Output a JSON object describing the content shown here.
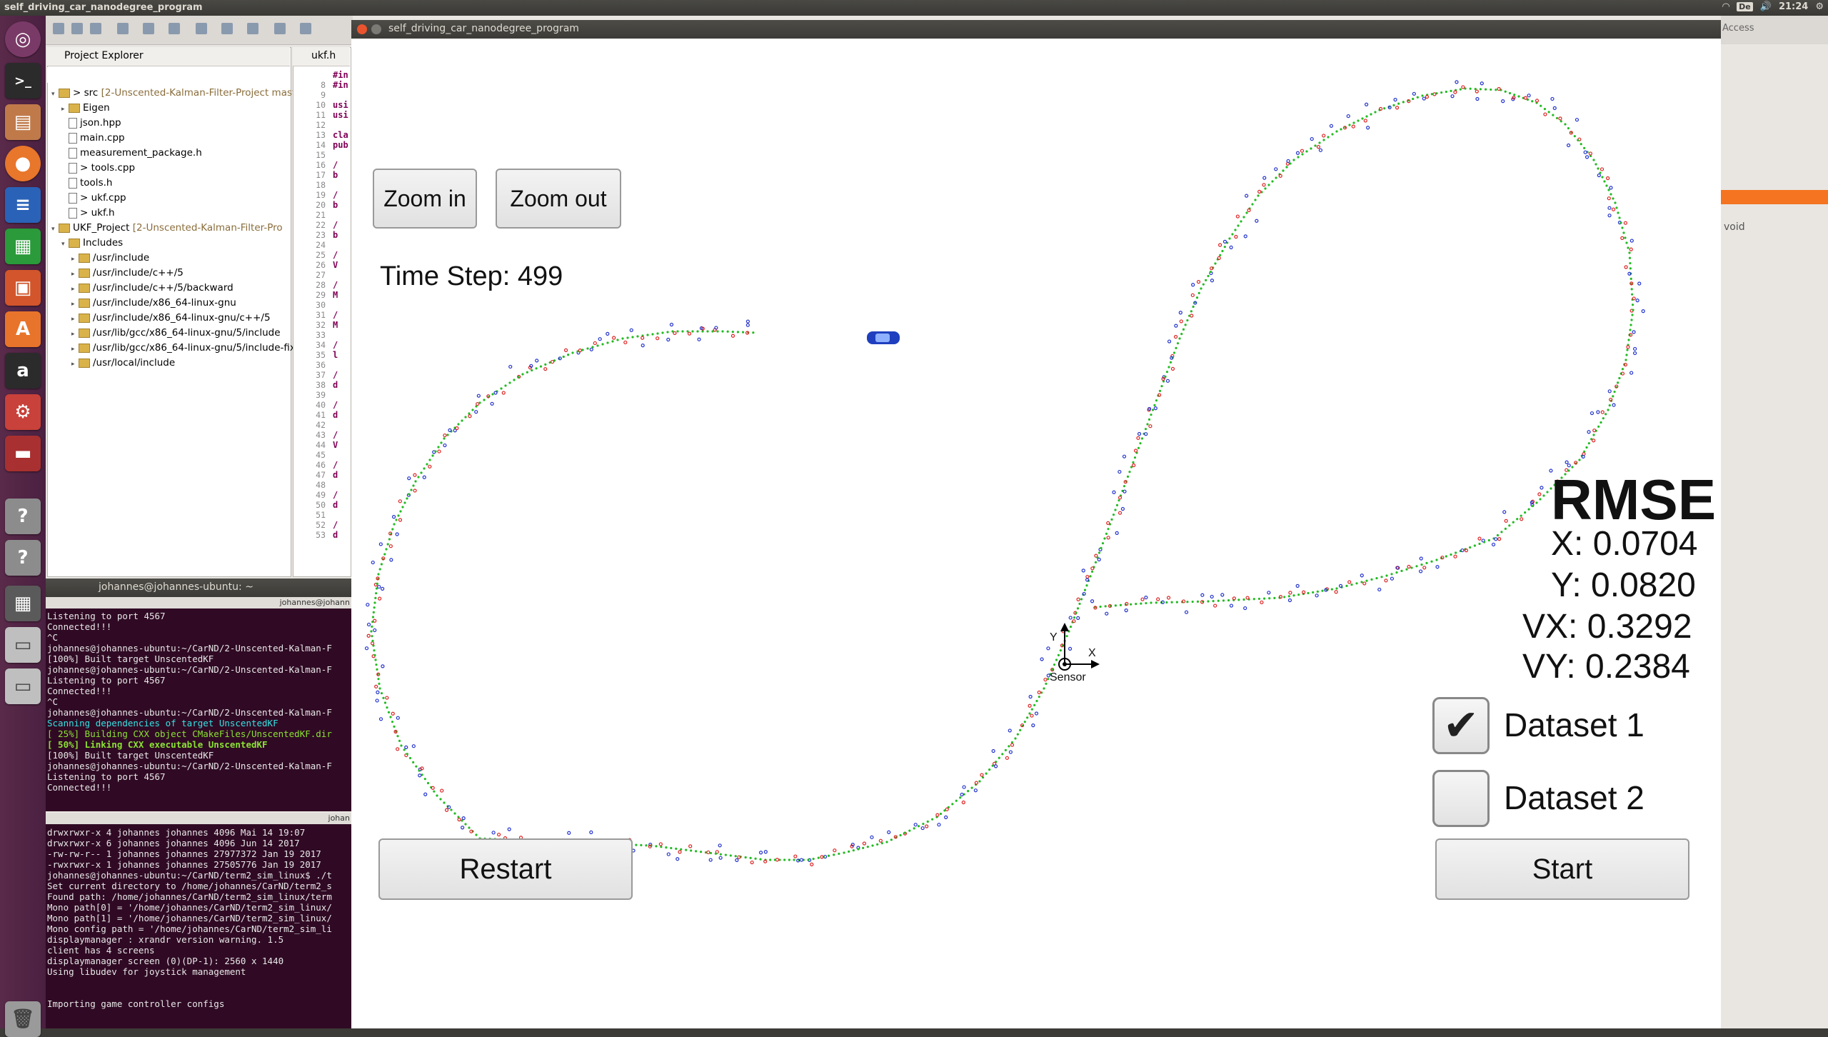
{
  "top_panel": {
    "title": "self_driving_car_nanodegree_program",
    "keyboard": "De",
    "time": "21:24"
  },
  "launcher": {
    "items": [
      "terminal-icon",
      "files-icon",
      "firefox-icon",
      "writer-icon",
      "calc-icon",
      "impress-icon",
      "software-icon",
      "amazon-icon",
      "settings-icon",
      "monitor-icon",
      "unknown-app-icon",
      "unknown-app-icon",
      "calculator-icon",
      "drive-icon",
      "drive-icon",
      "trash-icon"
    ]
  },
  "project_explorer": {
    "title": "Project Explorer",
    "rows": [
      {
        "label": "src",
        "sub": " [2-Unscented-Kalman-Filter-Project mast",
        "depth": 0,
        "type": "folder",
        "expanded": true,
        "prefix": ">"
      },
      {
        "label": "Eigen",
        "sub": "",
        "depth": 1,
        "type": "folder",
        "expanded": false,
        "prefix": ""
      },
      {
        "label": "json.hpp",
        "sub": "",
        "depth": 1,
        "type": "file",
        "prefix": ""
      },
      {
        "label": "main.cpp",
        "sub": "",
        "depth": 1,
        "type": "file",
        "prefix": ""
      },
      {
        "label": "measurement_package.h",
        "sub": "",
        "depth": 1,
        "type": "file",
        "prefix": ""
      },
      {
        "label": "tools.cpp",
        "sub": "",
        "depth": 1,
        "type": "file",
        "prefix": ">"
      },
      {
        "label": "tools.h",
        "sub": "",
        "depth": 1,
        "type": "file",
        "prefix": ""
      },
      {
        "label": "ukf.cpp",
        "sub": "",
        "depth": 1,
        "type": "file",
        "prefix": ">"
      },
      {
        "label": "ukf.h",
        "sub": "",
        "depth": 1,
        "type": "file",
        "prefix": ">"
      },
      {
        "label": "UKF_Project",
        "sub": " [2-Unscented-Kalman-Filter-Pro",
        "depth": 0,
        "type": "folder",
        "expanded": true,
        "prefix": ""
      },
      {
        "label": "Includes",
        "sub": "",
        "depth": 1,
        "type": "folder",
        "expanded": true,
        "prefix": ""
      },
      {
        "label": "/usr/include",
        "sub": "",
        "depth": 2,
        "type": "folder",
        "prefix": ""
      },
      {
        "label": "/usr/include/c++/5",
        "sub": "",
        "depth": 2,
        "type": "folder",
        "prefix": ""
      },
      {
        "label": "/usr/include/c++/5/backward",
        "sub": "",
        "depth": 2,
        "type": "folder",
        "prefix": ""
      },
      {
        "label": "/usr/include/x86_64-linux-gnu",
        "sub": "",
        "depth": 2,
        "type": "folder",
        "prefix": ""
      },
      {
        "label": "/usr/include/x86_64-linux-gnu/c++/5",
        "sub": "",
        "depth": 2,
        "type": "folder",
        "prefix": ""
      },
      {
        "label": "/usr/lib/gcc/x86_64-linux-gnu/5/include",
        "sub": "",
        "depth": 2,
        "type": "folder",
        "prefix": ""
      },
      {
        "label": "/usr/lib/gcc/x86_64-linux-gnu/5/include-fix",
        "sub": "",
        "depth": 2,
        "type": "folder",
        "prefix": ""
      },
      {
        "label": "/usr/local/include",
        "sub": "",
        "depth": 2,
        "type": "folder",
        "prefix": ""
      }
    ]
  },
  "editor": {
    "tab": "ukf.h",
    "lines": [
      {
        "n": "",
        "t": "#in"
      },
      {
        "n": "8",
        "t": "#in"
      },
      {
        "n": "9",
        "t": ""
      },
      {
        "n": "10",
        "t": "usi"
      },
      {
        "n": "11",
        "t": "usi"
      },
      {
        "n": "12",
        "t": ""
      },
      {
        "n": "13",
        "t": "cla"
      },
      {
        "n": "14",
        "t": "pub"
      },
      {
        "n": "15",
        "t": ""
      },
      {
        "n": "16",
        "t": "/"
      },
      {
        "n": "17",
        "t": "b"
      },
      {
        "n": "18",
        "t": ""
      },
      {
        "n": "19",
        "t": "/"
      },
      {
        "n": "20",
        "t": "b"
      },
      {
        "n": "21",
        "t": ""
      },
      {
        "n": "22",
        "t": "/"
      },
      {
        "n": "23",
        "t": "b"
      },
      {
        "n": "24",
        "t": ""
      },
      {
        "n": "25",
        "t": "/"
      },
      {
        "n": "26",
        "t": "V"
      },
      {
        "n": "27",
        "t": ""
      },
      {
        "n": "28",
        "t": "/"
      },
      {
        "n": "29",
        "t": "M"
      },
      {
        "n": "30",
        "t": ""
      },
      {
        "n": "31",
        "t": "/"
      },
      {
        "n": "32",
        "t": "M"
      },
      {
        "n": "33",
        "t": ""
      },
      {
        "n": "34",
        "t": "/"
      },
      {
        "n": "35",
        "t": "l"
      },
      {
        "n": "36",
        "t": ""
      },
      {
        "n": "37",
        "t": "/"
      },
      {
        "n": "38",
        "t": "d"
      },
      {
        "n": "39",
        "t": ""
      },
      {
        "n": "40",
        "t": "/"
      },
      {
        "n": "41",
        "t": "d"
      },
      {
        "n": "42",
        "t": ""
      },
      {
        "n": "43",
        "t": "/"
      },
      {
        "n": "44",
        "t": "V"
      },
      {
        "n": "45",
        "t": ""
      },
      {
        "n": "46",
        "t": "/"
      },
      {
        "n": "47",
        "t": "d"
      },
      {
        "n": "48",
        "t": ""
      },
      {
        "n": "49",
        "t": "/"
      },
      {
        "n": "50",
        "t": "d"
      },
      {
        "n": "51",
        "t": ""
      },
      {
        "n": "52",
        "t": "/"
      },
      {
        "n": "53",
        "t": "d"
      }
    ]
  },
  "terminal1": {
    "title": "johannes@johannes-ubuntu: ~",
    "tab_label": "johannes@johann",
    "lines": [
      {
        "t": "Listening to port 4567",
        "c": ""
      },
      {
        "t": "Connected!!!",
        "c": ""
      },
      {
        "t": "^C",
        "c": ""
      },
      {
        "t": "johannes@johannes-ubuntu:~/CarND/2-Unscented-Kalman-F",
        "c": ""
      },
      {
        "t": "[100%] Built target UnscentedKF",
        "c": ""
      },
      {
        "t": "johannes@johannes-ubuntu:~/CarND/2-Unscented-Kalman-F",
        "c": ""
      },
      {
        "t": "Listening to port 4567",
        "c": ""
      },
      {
        "t": "Connected!!!",
        "c": ""
      },
      {
        "t": "^C",
        "c": ""
      },
      {
        "t": "johannes@johannes-ubuntu:~/CarND/2-Unscented-Kalman-F",
        "c": ""
      },
      {
        "t": "Scanning dependencies of target UnscentedKF",
        "c": "cyan"
      },
      {
        "t": "[ 25%] Building CXX object CMakeFiles/UnscentedKF.dir",
        "c": "green"
      },
      {
        "t": "[ 50%] Linking CXX executable UnscentedKF",
        "c": "gbold"
      },
      {
        "t": "[100%] Built target UnscentedKF",
        "c": ""
      },
      {
        "t": "johannes@johannes-ubuntu:~/CarND/2-Unscented-Kalman-F",
        "c": ""
      },
      {
        "t": "Listening to port 4567",
        "c": ""
      },
      {
        "t": "Connected!!!",
        "c": ""
      }
    ]
  },
  "terminal2": {
    "tab_label": "johan",
    "lines": [
      "drwxrwxr-x 4 johannes johannes     4096 Mai 14 19:07",
      "drwxrwxr-x 6 johannes johannes     4096 Jun 14  2017",
      "-rw-rw-r-- 1 johannes johannes 27977372 Jan 19  2017",
      "-rwxrwxr-x 1 johannes johannes 27505776 Jan 19  2017",
      "johannes@johannes-ubuntu:~/CarND/term2_sim_linux$ ./t",
      "Set current directory to /home/johannes/CarND/term2_s",
      "Found path: /home/johannes/CarND/term2_sim_linux/term",
      "Mono path[0] = '/home/johannes/CarND/term2_sim_linux/",
      "Mono path[1] = '/home/johannes/CarND/term2_sim_linux/",
      "Mono config path = '/home/johannes/CarND/term2_sim_li",
      "displaymanager : xrandr version warning. 1.5",
      "client has 4 screens",
      "displaymanager screen (0)(DP-1): 2560 x 1440",
      "Using libudev for joystick management",
      "",
      "",
      "Importing game controller configs"
    ]
  },
  "right_strip": {
    "access": "Access",
    "void": "void"
  },
  "simulator": {
    "title": "self_driving_car_nanodegree_program",
    "zoom_in": "Zoom in",
    "zoom_out": "Zoom out",
    "time_step": "Time Step: 499",
    "rmse_title": "RMSE",
    "rmse_x": "X: 0.0704",
    "rmse_y": "Y: 0.0820",
    "rmse_vx": "VX: 0.3292",
    "rmse_vy": "VY: 0.2384",
    "dataset1": "Dataset 1",
    "dataset1_checked": true,
    "dataset2": "Dataset 2",
    "dataset2_checked": false,
    "restart": "Restart",
    "start": "Start",
    "sensor_label": "Sensor",
    "axis_x": "X",
    "axis_y": "Y",
    "colors": {
      "estimate": "#22bb22",
      "lidar": "#dd2222",
      "radar": "#2233cc",
      "car": "#1f3fbf"
    }
  }
}
